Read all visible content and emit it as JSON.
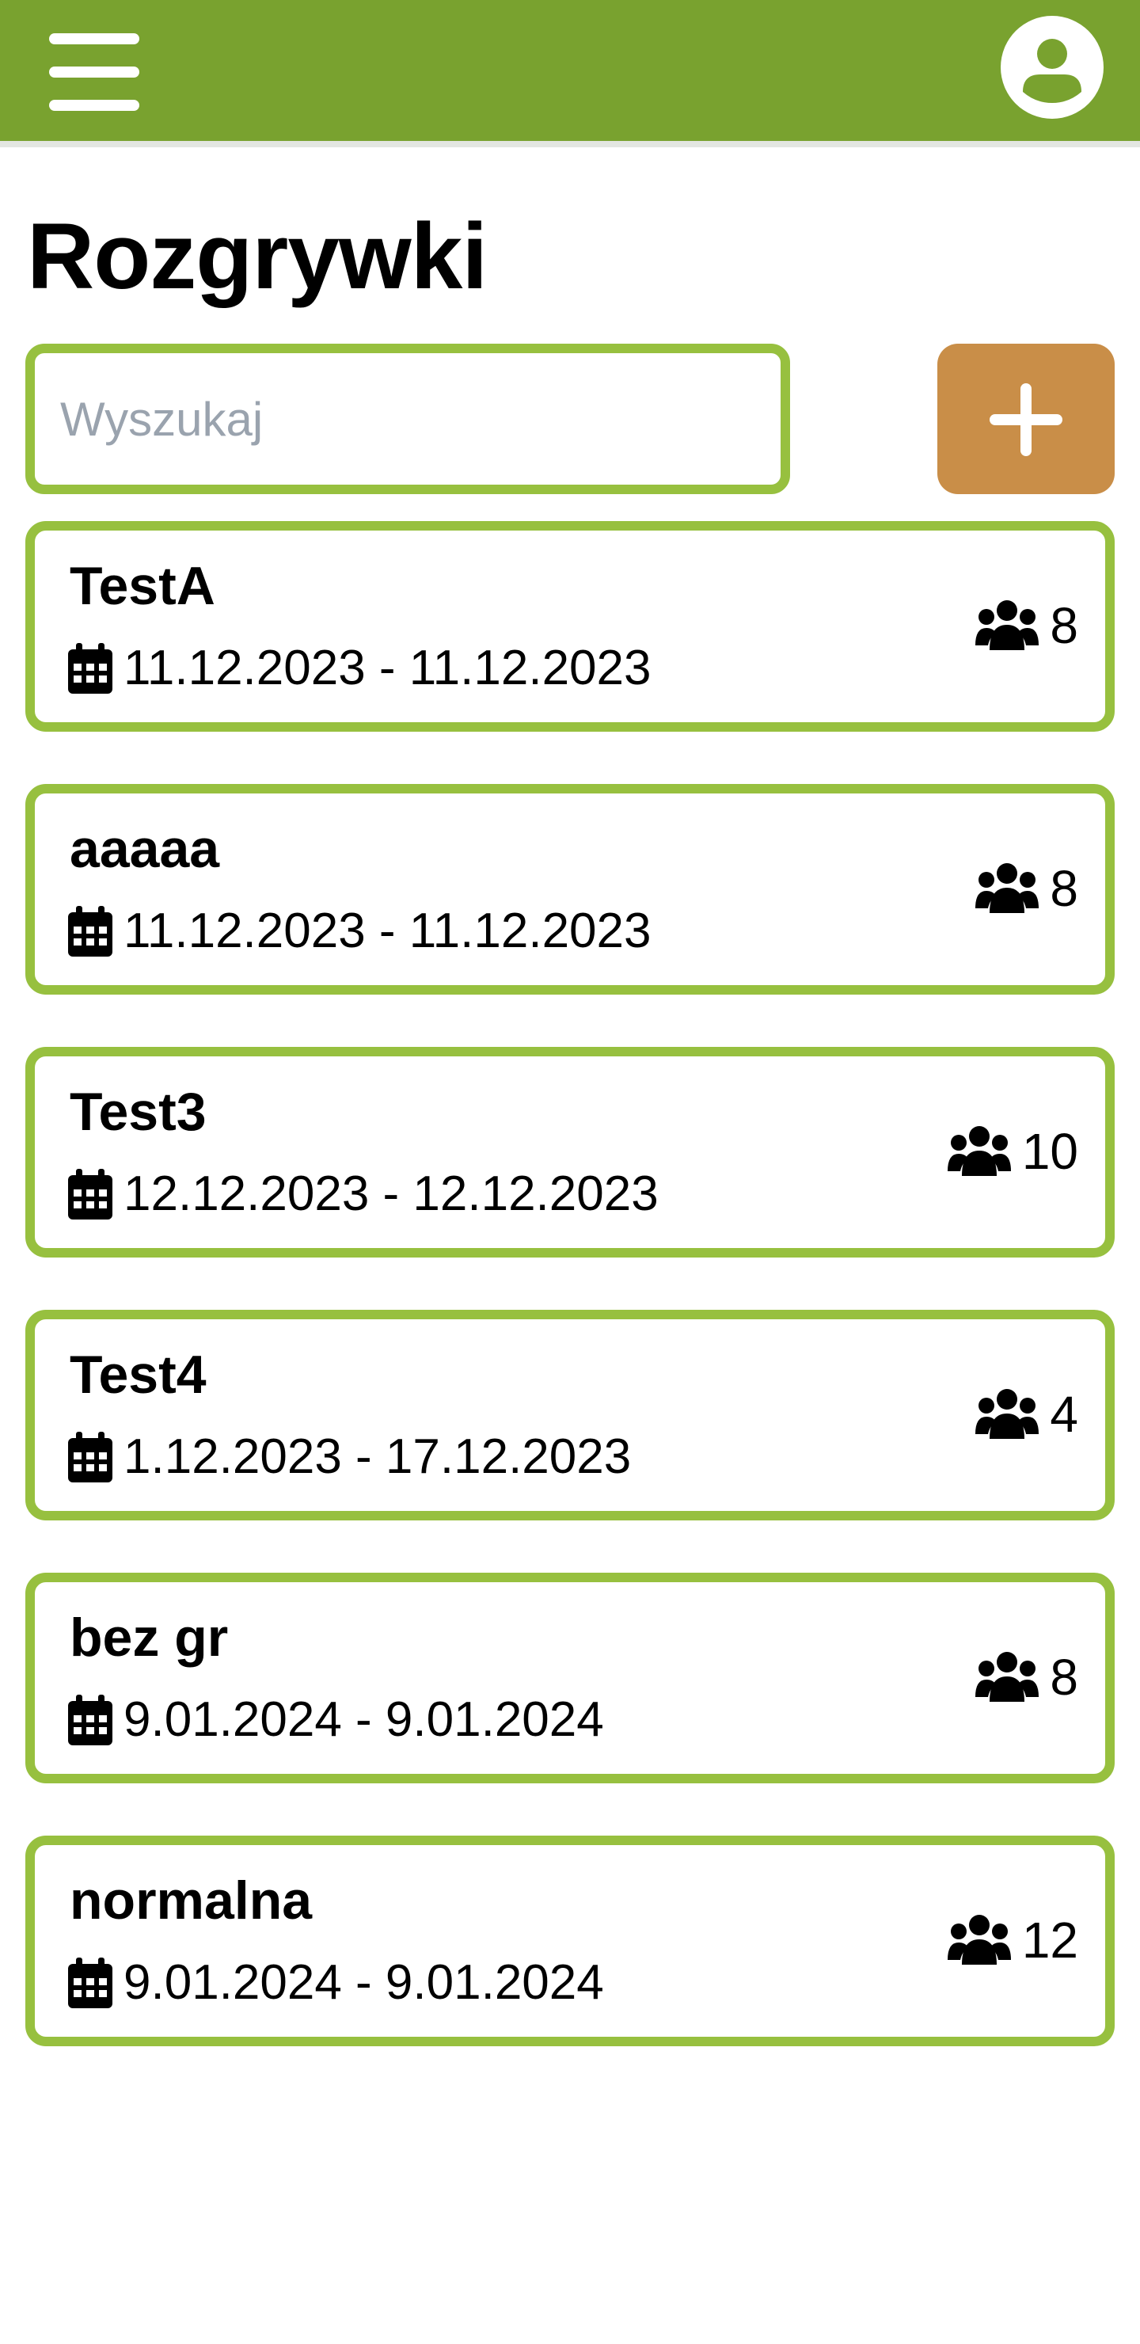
{
  "header": {
    "menu_icon": "hamburger-menu-icon",
    "profile_icon": "user-circle-icon",
    "bar_color": "#79a22f"
  },
  "page": {
    "title": "Rozgrywki"
  },
  "search": {
    "placeholder": "Wyszukaj",
    "value": ""
  },
  "add_button": {
    "icon": "plus-icon",
    "color": "#c98e48"
  },
  "accent_color": "#97c03f",
  "tournaments": [
    {
      "name": "TestA",
      "dates": "11.12.2023 - 11.12.2023",
      "players": "8"
    },
    {
      "name": "aaaaa",
      "dates": "11.12.2023 - 11.12.2023",
      "players": "8"
    },
    {
      "name": "Test3",
      "dates": "12.12.2023 - 12.12.2023",
      "players": "10"
    },
    {
      "name": "Test4",
      "dates": "1.12.2023 - 17.12.2023",
      "players": "4"
    },
    {
      "name": "bez gr",
      "dates": "9.01.2024 - 9.01.2024",
      "players": "8"
    },
    {
      "name": "normalna",
      "dates": "9.01.2024 - 9.01.2024",
      "players": "12"
    }
  ]
}
